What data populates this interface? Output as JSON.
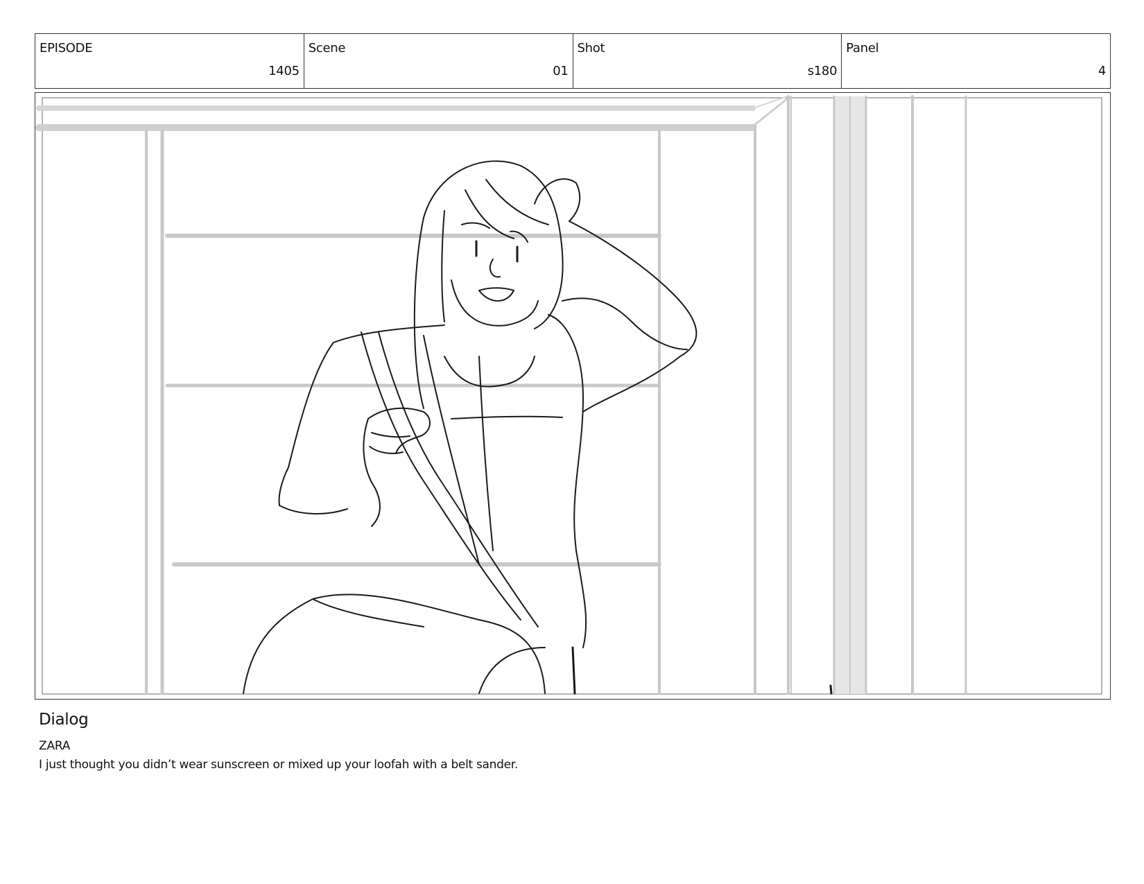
{
  "header": {
    "episode": {
      "label": "EPISODE",
      "value": "1405"
    },
    "scene": {
      "label": "Scene",
      "value": "01"
    },
    "shot": {
      "label": "Shot",
      "value": "s180"
    },
    "panel": {
      "label": "Panel",
      "value": "4"
    }
  },
  "dialog": {
    "heading": "Dialog",
    "speaker": "ZARA",
    "line": "I just thought you didn’t wear sunscreen or mixed up your loofah with a belt sander."
  }
}
